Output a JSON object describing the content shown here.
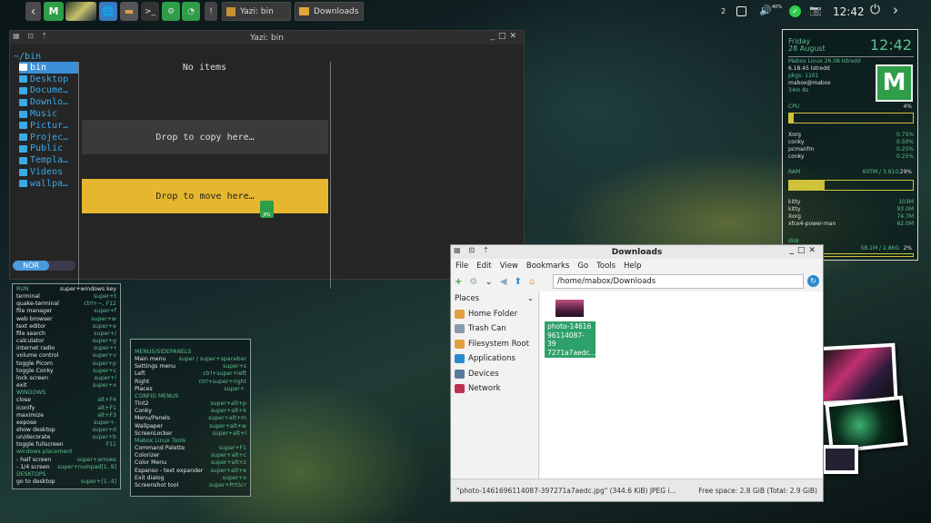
{
  "panel": {
    "tasks": [
      {
        "label": "Yazi: bin"
      },
      {
        "label": "Downloads"
      }
    ],
    "workspace": "2",
    "volume": "40%",
    "clock": "12:42"
  },
  "yazi": {
    "title": "Yazi: bin",
    "path": "~/bin",
    "items": [
      "bin",
      "Desktop",
      "Docume…",
      "Downlo…",
      "Music",
      "Pictur…",
      "Projec…",
      "Public",
      "Templa…",
      "Videos",
      "wallpa…"
    ],
    "empty": "No items",
    "drop_copy": "Drop to copy here…",
    "drop_move": "Drop to move here…",
    "file_tag": "JPG",
    "mode": "NOR"
  },
  "kb1": [
    {
      "k": "RUN",
      "v": "super+windows key",
      "h": true
    },
    {
      "k": "terminal",
      "v": "super+t"
    },
    {
      "k": "quake-terminal",
      "v": "ctrl+~, F12"
    },
    {
      "k": "file manager",
      "v": "super+f"
    },
    {
      "k": "web browser",
      "v": "super+w"
    },
    {
      "k": "text editor",
      "v": "super+e"
    },
    {
      "k": "file search",
      "v": "super+/"
    },
    {
      "k": "calculator",
      "v": "super+g"
    },
    {
      "k": "internet radio",
      "v": "super+r"
    },
    {
      "k": "volume control",
      "v": "super+v"
    },
    {
      "k": "toggle Picom",
      "v": "super+p"
    },
    {
      "k": "toggle Conky",
      "v": "super+c"
    },
    {
      "k": "lock screen",
      "v": "super+l"
    },
    {
      "k": "exit",
      "v": "super+x"
    },
    {
      "k": "WINDOWS",
      "v": "",
      "h": true
    },
    {
      "k": "close",
      "v": "alt+F4"
    },
    {
      "k": "iconify",
      "v": "alt+F1"
    },
    {
      "k": "maximize",
      "v": "alt+F3"
    },
    {
      "k": "expose",
      "v": "super+-"
    },
    {
      "k": "show desktop",
      "v": "super+d"
    },
    {
      "k": "un/decorate",
      "v": "super+b"
    },
    {
      "k": "toggle fullscreen",
      "v": "F11"
    },
    {
      "k": "windows placement",
      "v": "",
      "h": true
    },
    {
      "k": "- half screen",
      "v": "super+arrows"
    },
    {
      "k": "- 1/4 screen",
      "v": "super+numpad[1..9]"
    },
    {
      "k": "DESKTOPS",
      "v": "",
      "h": true
    },
    {
      "k": "go to desktop",
      "v": "super+[1..4]"
    }
  ],
  "kb2": [
    {
      "k": "MENUS/SIDEPANELS",
      "v": "",
      "h": true
    },
    {
      "k": "Main menu",
      "v": "super / super+spacebar"
    },
    {
      "k": "Settings menu",
      "v": "super+s"
    },
    {
      "k": "Left",
      "v": "ctrl+super+left"
    },
    {
      "k": "Right",
      "v": "ctrl+super+right"
    },
    {
      "k": "Places",
      "v": "super+."
    },
    {
      "k": "CONFIG MENUS",
      "v": "",
      "h": true
    },
    {
      "k": "Tint2",
      "v": "super+alt+p"
    },
    {
      "k": "Conky",
      "v": "super+alt+k"
    },
    {
      "k": "Menu/Panels",
      "v": "super+alt+m"
    },
    {
      "k": "Wallpaper",
      "v": "super+alt+w"
    },
    {
      "k": "ScreenLocker",
      "v": "super+alt+l"
    },
    {
      "k": "Mabox Linux Tools",
      "v": "",
      "h": true
    },
    {
      "k": "Command Palette",
      "v": "super+F1"
    },
    {
      "k": "Colorizer",
      "v": "super+alt+c"
    },
    {
      "k": "Color Menu",
      "v": "super+alt+z"
    },
    {
      "k": "Espanso - text expander",
      "v": "super+alt+e"
    },
    {
      "k": "Exit dialog",
      "v": "super+x"
    },
    {
      "k": "Screenshot tool",
      "v": "super+PrtScr"
    }
  ],
  "conky": {
    "day": "Friday",
    "date": "28 August",
    "time": "12:42",
    "os": "Mabox Linux 26.08 Istredd",
    "kernel": "6.18.45 Istredd",
    "pkgs": "pkgs: 1101",
    "user": "mabox@mabox",
    "uptime": "34m 8s",
    "cpu_label": "CPU",
    "cpu_pct": "4%",
    "cpu_procs": [
      {
        "n": "Xorg",
        "v": "0.75%"
      },
      {
        "n": "conky",
        "v": "0.50%"
      },
      {
        "n": "pcmanfm",
        "v": "0.25%"
      },
      {
        "n": "conky",
        "v": "0.25%"
      }
    ],
    "ram_label": "RAM",
    "ram_used": "60TM / 3.81G",
    "ram_pct": "29%",
    "ram_fill": 0.29,
    "cpu_fill": 0.04,
    "ram_procs": [
      {
        "n": "kitty",
        "v": "103M"
      },
      {
        "n": "kitty",
        "v": "93.0M"
      },
      {
        "n": "Xorg",
        "v": "74.7M"
      },
      {
        "n": "xfce4-power-man",
        "v": "62.0M"
      }
    ],
    "disk_label": "disk",
    "disk_used": "58.1M / 2.86G",
    "disk_pct": "2%"
  },
  "thunar": {
    "title": "Downloads",
    "menu": [
      "File",
      "Edit",
      "View",
      "Bookmarks",
      "Go",
      "Tools",
      "Help"
    ],
    "path": "/home/mabox/Downloads",
    "places_label": "Places",
    "places": [
      "Home Folder",
      "Trash Can",
      "Filesystem Root",
      "Applications",
      "Devices",
      "Network"
    ],
    "file_name": "photo-1461696114087-397271a7aedc...",
    "file_l1": "photo-14616",
    "file_l2": "96114087-39",
    "file_l3": "7271a7aedc...",
    "status_left": "\"photo-1461696114087-397271a7aedc.jpg\" (344.6 KiB) JPEG i...",
    "status_right": "Free space: 2.8 GiB (Total: 2.9 GiB)"
  },
  "colors": {
    "accent": "#5fbf8e",
    "yazi_blue": "#3aaae6",
    "drop_yellow": "#e6b62e",
    "conky_bar": "#d0c23a"
  }
}
